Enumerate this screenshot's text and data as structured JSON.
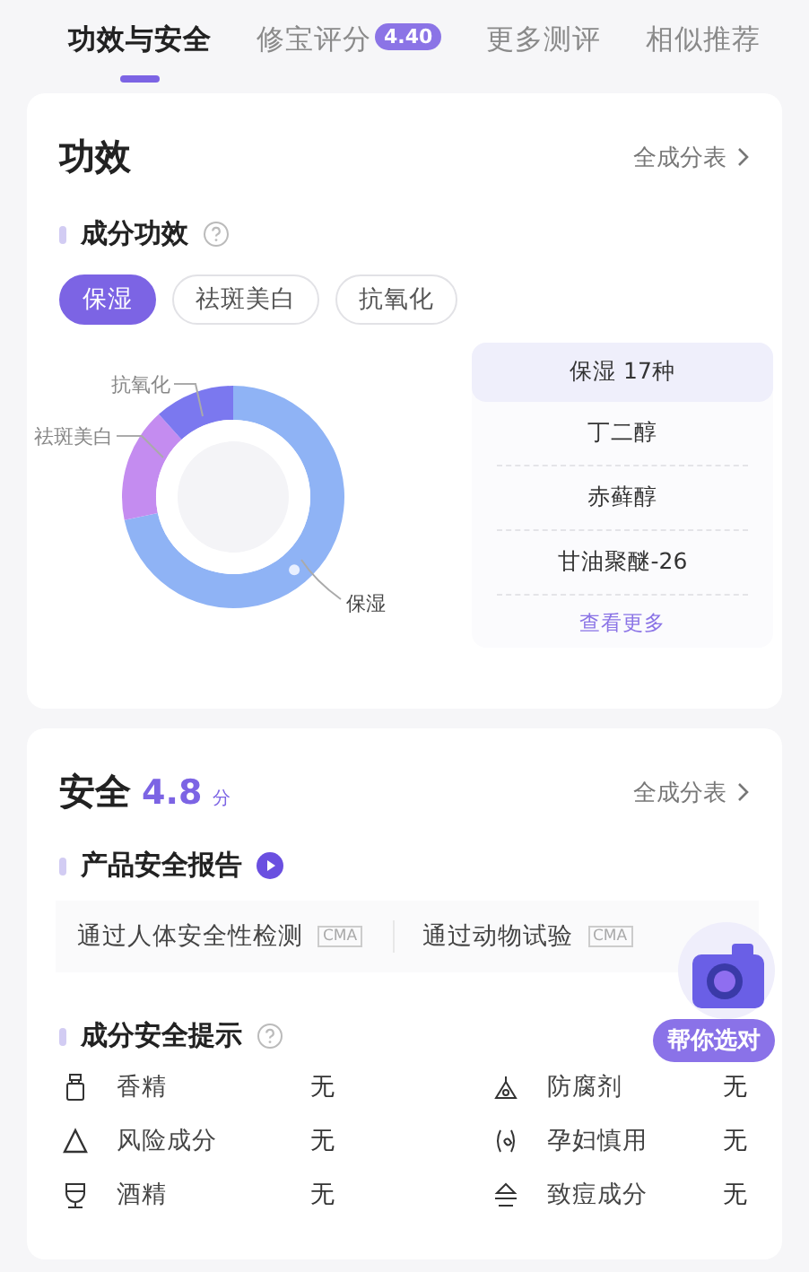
{
  "tabs": [
    {
      "label": "功效与安全",
      "selected": true
    },
    {
      "label": "修宝评分",
      "badge": "4.40",
      "selected": false
    },
    {
      "label": "更多测评",
      "selected": false
    },
    {
      "label": "相似推荐",
      "selected": false
    }
  ],
  "efficacy": {
    "title": "功效",
    "link": "全成分表",
    "section": "成分功效",
    "chips": [
      {
        "label": "保湿",
        "selected": true
      },
      {
        "label": "祛斑美白",
        "selected": false
      },
      {
        "label": "抗氧化",
        "selected": false
      }
    ],
    "donut": [
      {
        "label": "保湿",
        "color": "#8fb3f5"
      },
      {
        "label": "祛斑美白",
        "color": "#c48cf0"
      },
      {
        "label": "抗氧化",
        "color": "#7b78ef"
      }
    ],
    "list": {
      "header": "保湿 17种",
      "items": [
        "丁二醇",
        "赤藓醇",
        "甘油聚醚-26"
      ],
      "more": "查看更多"
    }
  },
  "safety": {
    "title": "安全",
    "score": "4.8",
    "unit": "分",
    "link": "全成分表",
    "report": "产品安全报告",
    "tests": [
      {
        "label": "通过人体安全性检测",
        "tag": "CMA"
      },
      {
        "label": "通过动物试验",
        "tag": "CMA"
      }
    ],
    "tips_title": "成分安全提示",
    "tips": [
      {
        "kind": "perfume",
        "name": "香精",
        "value": "无"
      },
      {
        "kind": "preservative",
        "name": "防腐剂",
        "value": "无"
      },
      {
        "kind": "risk",
        "name": "风险成分",
        "value": "无"
      },
      {
        "kind": "pregnancy",
        "name": "孕妇慎用",
        "value": "无"
      },
      {
        "kind": "alcohol",
        "name": "酒精",
        "value": "无"
      },
      {
        "kind": "carcinogen",
        "name": "致痘成分",
        "value": "无"
      }
    ]
  },
  "float_button": "帮你选对"
}
